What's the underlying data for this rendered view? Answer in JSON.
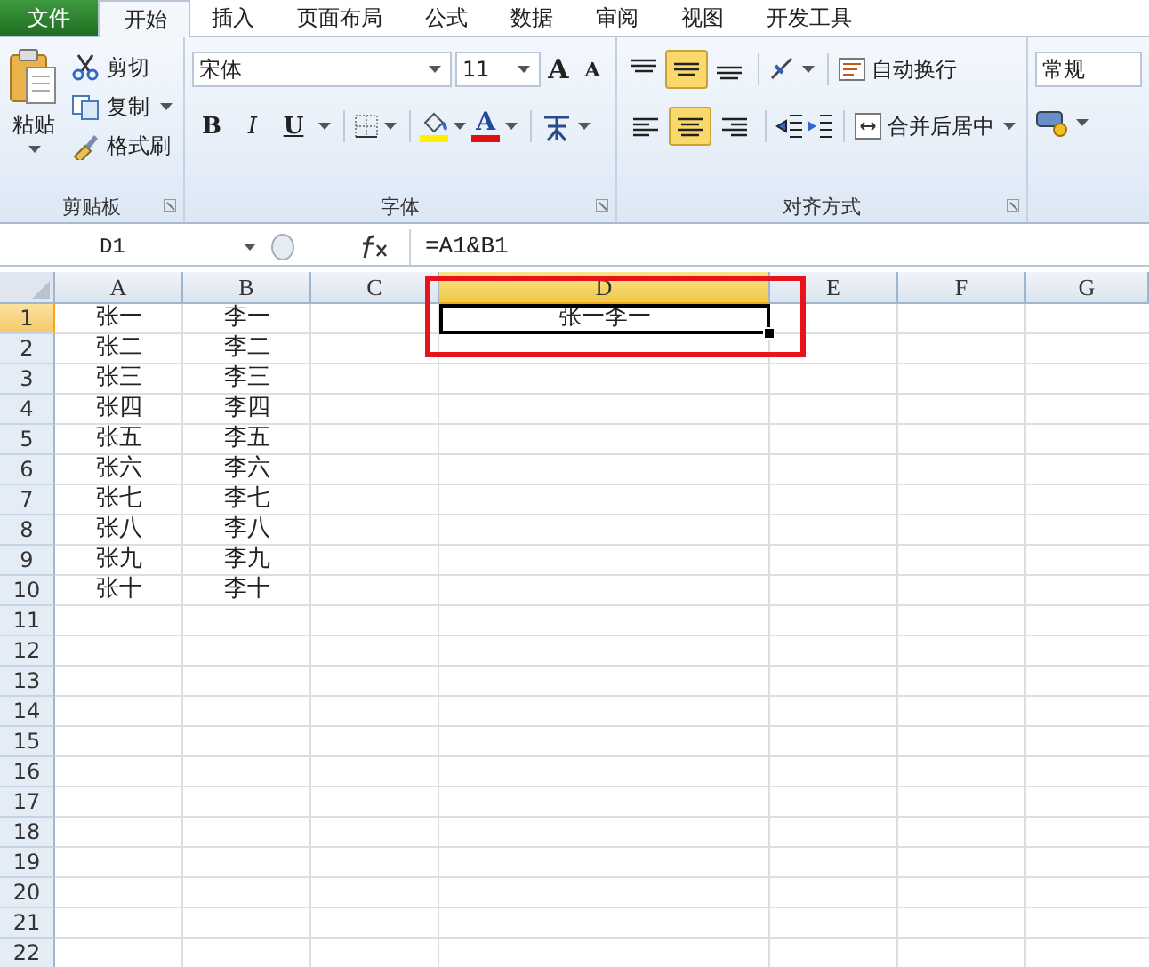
{
  "file_tab": {
    "label": "文件"
  },
  "tabs": [
    {
      "label": "开始",
      "selected": true
    },
    {
      "label": "插入",
      "selected": false
    },
    {
      "label": "页面布局",
      "selected": false
    },
    {
      "label": "公式",
      "selected": false
    },
    {
      "label": "数据",
      "selected": false
    },
    {
      "label": "审阅",
      "selected": false
    },
    {
      "label": "视图",
      "selected": false
    },
    {
      "label": "开发工具",
      "selected": false
    }
  ],
  "clipboard": {
    "paste": "粘贴",
    "items": [
      {
        "kind": "cut",
        "label": "剪切"
      },
      {
        "kind": "copy",
        "label": "复制"
      },
      {
        "kind": "brush",
        "label": "格式刷"
      }
    ],
    "label": "剪贴板"
  },
  "font": {
    "name": "宋体",
    "size": "11",
    "grow": "A",
    "shrink": "A",
    "styles": [
      "B",
      "I",
      "U"
    ],
    "color_label": "A",
    "label": "字体"
  },
  "alignment": {
    "vertical": [
      {
        "selected": false
      },
      {
        "selected": true
      },
      {
        "selected": false
      }
    ],
    "horizontal": [
      {
        "selected": false
      },
      {
        "selected": true
      },
      {
        "selected": false
      }
    ],
    "wrap": "自动换行",
    "merge": "合并后居中",
    "label": "对齐方式"
  },
  "number": {
    "format": "常规"
  },
  "formula_bar": {
    "name_box": "D1",
    "formula": "=A1&B1"
  },
  "columns": [
    {
      "label": "A",
      "selected": false
    },
    {
      "label": "B",
      "selected": false
    },
    {
      "label": "C",
      "selected": false
    },
    {
      "label": "D",
      "selected": true
    },
    {
      "label": "E",
      "selected": false
    },
    {
      "label": "F",
      "selected": false
    },
    {
      "label": "G",
      "selected": false
    }
  ],
  "rows": [
    {
      "label": "1",
      "selected": true,
      "cells": [
        {
          "text": "张一",
          "active": false
        },
        {
          "text": "李一",
          "active": false
        },
        {
          "active": false
        },
        {
          "text": "张一李一",
          "active": true
        }
      ]
    },
    {
      "label": "2",
      "selected": false,
      "cells": [
        {
          "text": "张二",
          "active": false
        },
        {
          "text": "李二",
          "active": false
        }
      ]
    },
    {
      "label": "3",
      "selected": false,
      "cells": [
        {
          "text": "张三",
          "active": false
        },
        {
          "text": "李三",
          "active": false
        }
      ]
    },
    {
      "label": "4",
      "selected": false,
      "cells": [
        {
          "text": "张四",
          "active": false
        },
        {
          "text": "李四",
          "active": false
        }
      ]
    },
    {
      "label": "5",
      "selected": false,
      "cells": [
        {
          "text": "张五",
          "active": false
        },
        {
          "text": "李五",
          "active": false
        }
      ]
    },
    {
      "label": "6",
      "selected": false,
      "cells": [
        {
          "text": "张六",
          "active": false
        },
        {
          "text": "李六",
          "active": false
        }
      ]
    },
    {
      "label": "7",
      "selected": false,
      "cells": [
        {
          "text": "张七",
          "active": false
        },
        {
          "text": "李七",
          "active": false
        }
      ]
    },
    {
      "label": "8",
      "selected": false,
      "cells": [
        {
          "text": "张八",
          "active": false
        },
        {
          "text": "李八",
          "active": false
        }
      ]
    },
    {
      "label": "9",
      "selected": false,
      "cells": [
        {
          "text": "张九",
          "active": false
        },
        {
          "text": "李九",
          "active": false
        }
      ]
    },
    {
      "label": "10",
      "selected": false,
      "cells": [
        {
          "text": "张十",
          "active": false
        },
        {
          "text": "李十",
          "active": false
        }
      ]
    },
    {
      "label": "11",
      "selected": false,
      "cells": []
    },
    {
      "label": "12",
      "selected": false,
      "cells": []
    },
    {
      "label": "13",
      "selected": false,
      "cells": []
    },
    {
      "label": "14",
      "selected": false,
      "cells": []
    },
    {
      "label": "15",
      "selected": false,
      "cells": []
    },
    {
      "label": "16",
      "selected": false,
      "cells": []
    },
    {
      "label": "17",
      "selected": false,
      "cells": []
    },
    {
      "label": "18",
      "selected": false,
      "cells": []
    },
    {
      "label": "19",
      "selected": false,
      "cells": []
    },
    {
      "label": "20",
      "selected": false,
      "cells": []
    },
    {
      "label": "21",
      "selected": false,
      "cells": []
    },
    {
      "label": "22",
      "selected": false,
      "cells": []
    }
  ],
  "annotation": {
    "kind": "highlight-box",
    "color": "#e8141b"
  }
}
